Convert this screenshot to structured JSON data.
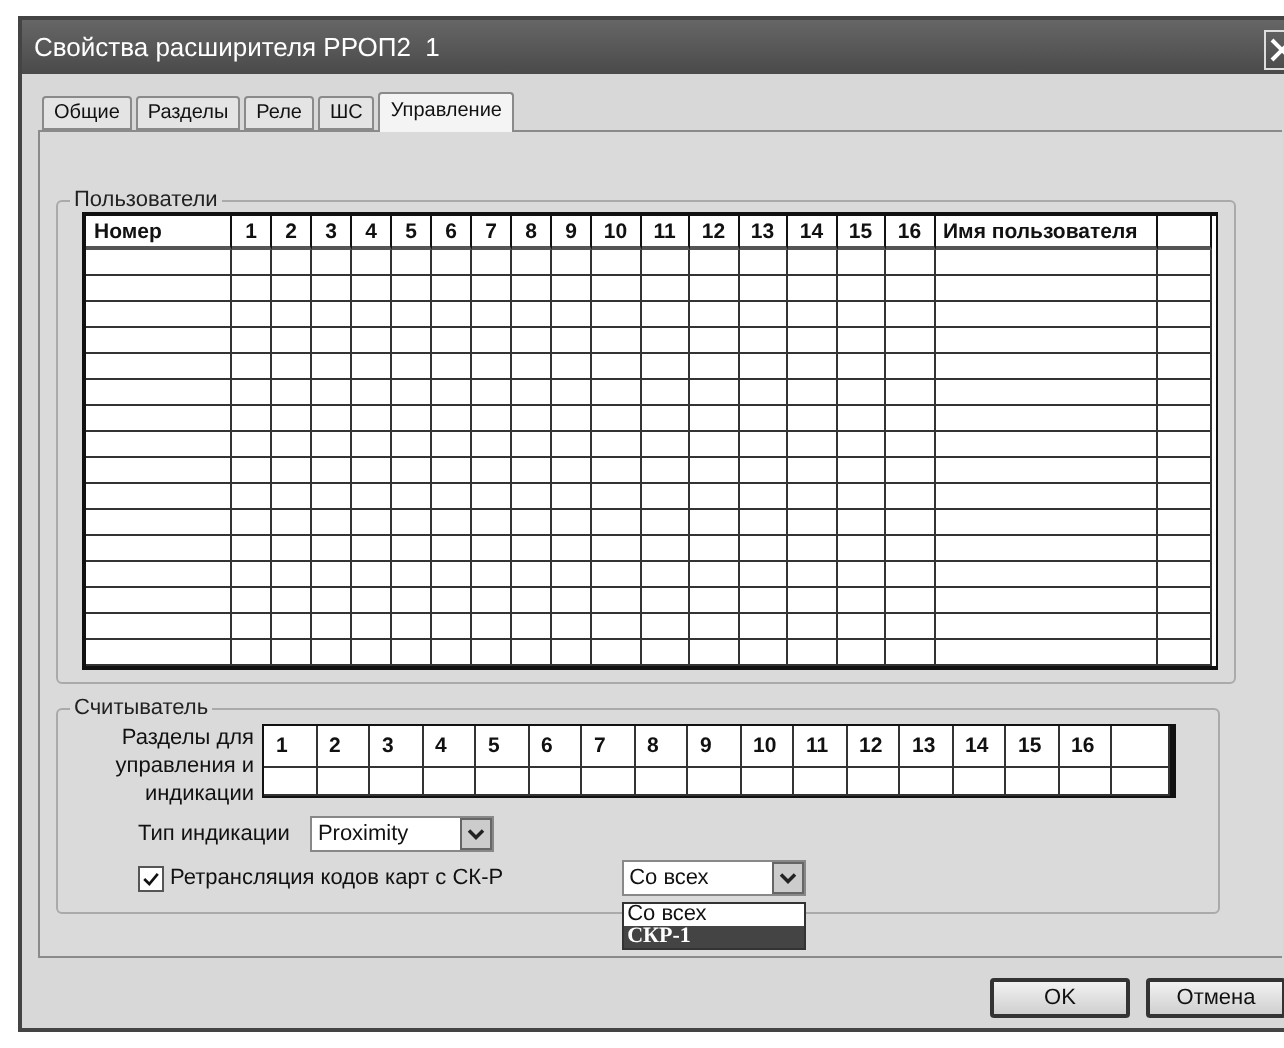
{
  "window": {
    "title": "Свойства расширителя РРОП2  1"
  },
  "tabs": [
    {
      "label": "Общие",
      "selected": false
    },
    {
      "label": "Разделы",
      "selected": false
    },
    {
      "label": "Реле",
      "selected": false
    },
    {
      "label": "ШС",
      "selected": false
    },
    {
      "label": "Управление",
      "selected": true
    }
  ],
  "users": {
    "legend": "Пользователи",
    "columns": [
      "Номер",
      "1",
      "2",
      "3",
      "4",
      "5",
      "6",
      "7",
      "8",
      "9",
      "10",
      "11",
      "12",
      "13",
      "14",
      "15",
      "16",
      "Имя пользователя"
    ]
  },
  "reader": {
    "legend": "Считыватель",
    "sections_label": "Разделы для управления и индикации",
    "columns": [
      "1",
      "2",
      "3",
      "4",
      "5",
      "6",
      "7",
      "8",
      "9",
      "10",
      "11",
      "12",
      "13",
      "14",
      "15",
      "16"
    ],
    "indication_label": "Тип индикации",
    "indication_value": "Proximity",
    "relay": {
      "label": "Ретрансляция кодов карт с СК-Р",
      "checked": true
    },
    "source_value": "Со всех",
    "source_options": [
      {
        "label": "Со всех",
        "selected": false
      },
      {
        "label": "СКР-1",
        "selected": true
      }
    ]
  },
  "buttons": [
    "OK",
    "Отмена"
  ]
}
